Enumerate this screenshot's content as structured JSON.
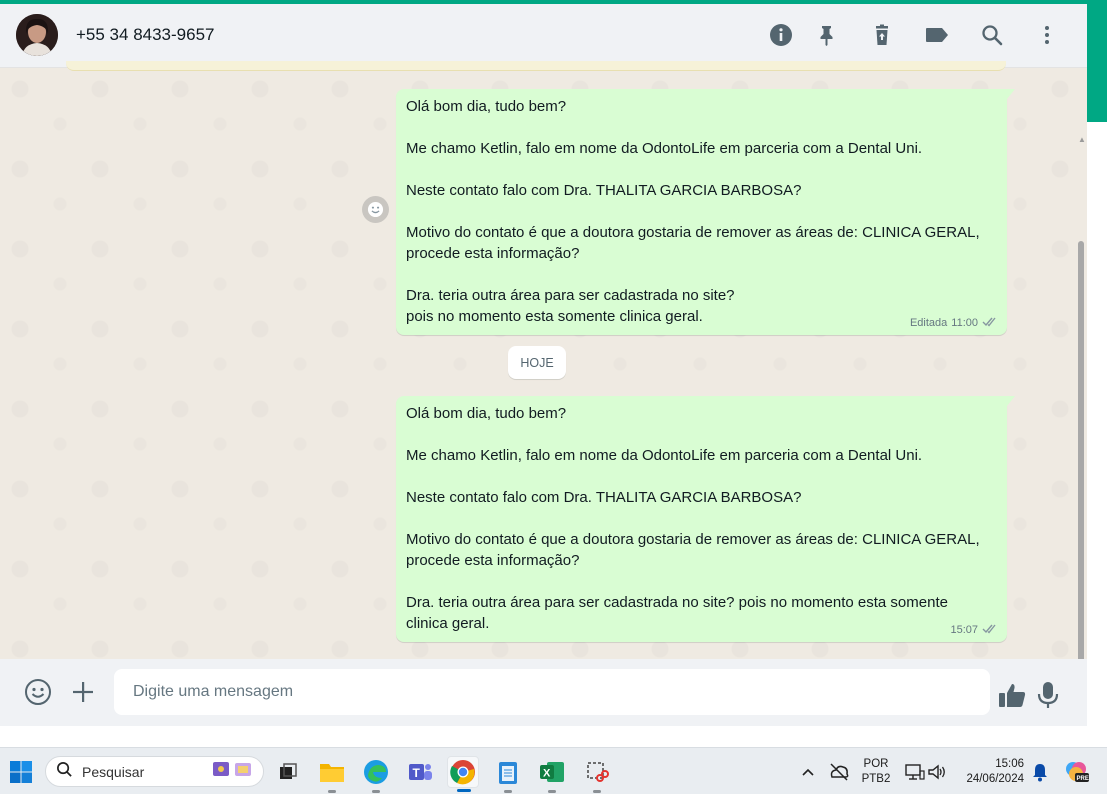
{
  "header": {
    "contact_name": "+55 34 8433-9657",
    "icons": [
      "info-icon",
      "pin-icon",
      "delete-icon",
      "label-icon",
      "search-icon",
      "menu-icon"
    ]
  },
  "messages": [
    {
      "lines": [
        "Olá bom dia, tudo bem?",
        "",
        "Me chamo Ketlin, falo em nome da OdontoLife em parceria com a Dental Uni.",
        "",
        "Neste contato falo com Dra. THALITA GARCIA BARBOSA?",
        "",
        "Motivo do contato é que a doutora gostaria de remover as áreas de: CLINICA GERAL,",
        "procede esta informação?",
        "",
        "Dra. teria outra área para ser cadastrada no site?",
        "pois no momento esta somente clinica geral."
      ],
      "edited_label": "Editada",
      "time": "11:00",
      "status": "read"
    },
    {
      "lines": [
        "Olá bom dia, tudo bem?",
        "",
        "Me chamo Ketlin, falo em nome da OdontoLife em parceria com a Dental Uni.",
        "",
        "Neste contato falo com Dra. THALITA GARCIA BARBOSA?",
        "",
        "Motivo do contato é que a doutora gostaria de remover as áreas de: CLINICA GERAL,",
        "procede esta informação?",
        "",
        "Dra. teria outra área para ser cadastrada no site? pois no momento esta somente",
        "clinica geral."
      ],
      "time": "15:07",
      "status": "read"
    }
  ],
  "date_divider": "HOJE",
  "composer": {
    "placeholder": "Digite uma mensagem"
  },
  "taskbar": {
    "search_placeholder": "Pesquisar",
    "language_line1": "POR",
    "language_line2": "PTB2",
    "time": "15:06",
    "date": "24/06/2024"
  },
  "colors": {
    "accent": "#00a884",
    "bubble_out": "#d9fdd3",
    "chat_bg": "#efeae2",
    "tick_read": "#53bdeb"
  }
}
